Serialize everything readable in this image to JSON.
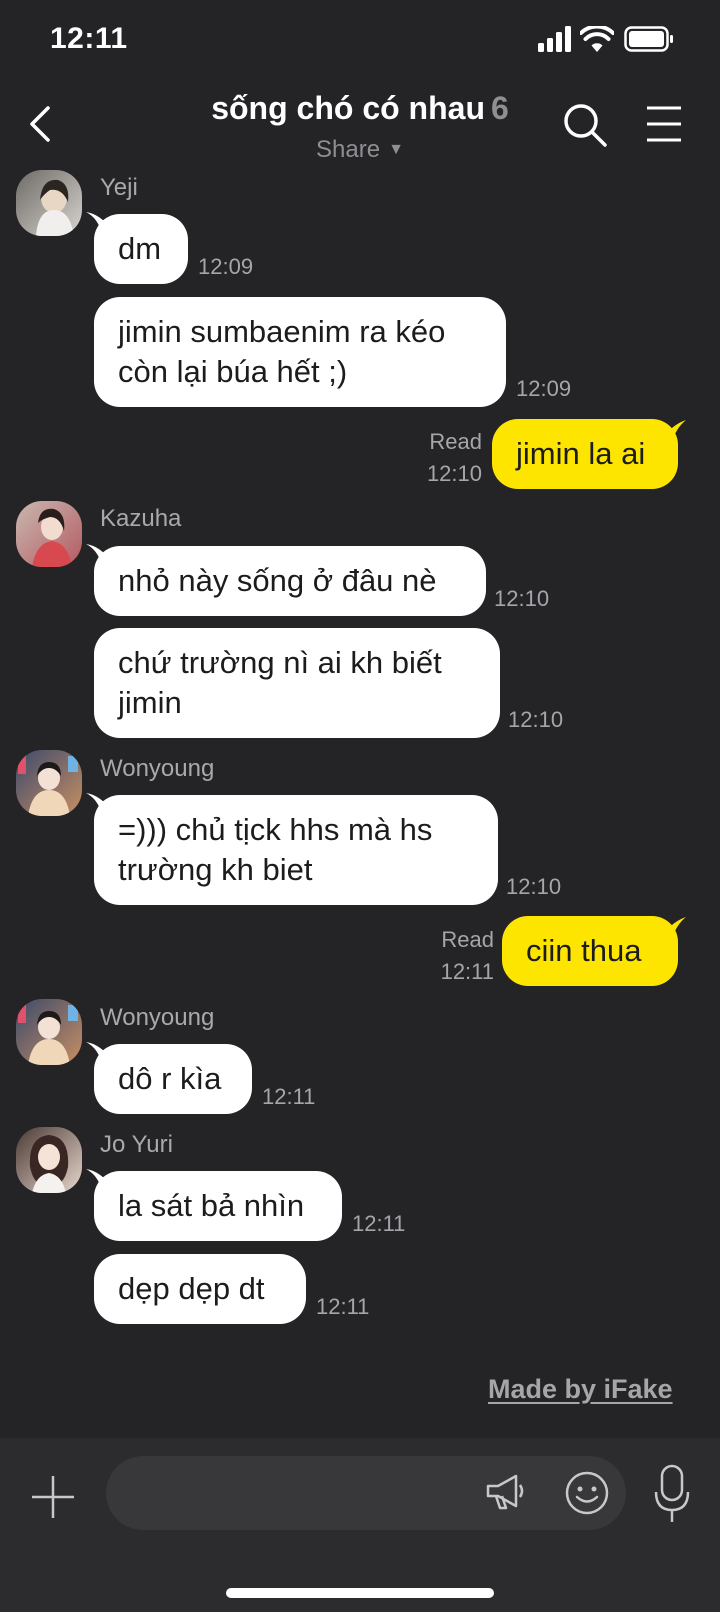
{
  "status_bar": {
    "time": "12:11"
  },
  "header": {
    "title": "sống chó có nhau",
    "member_count": "6",
    "subtitle": "Share"
  },
  "senders": {
    "yeji": "Yeji",
    "kazuha": "Kazuha",
    "wonyoung1": "Wonyoung",
    "wonyoung2": "Wonyoung",
    "joyuri": "Jo Yuri"
  },
  "messages": {
    "m1": {
      "text": "dm",
      "time": "12:09"
    },
    "m2": {
      "text": "jimin sumbaenim ra kéo\ncòn lại búa hết ;)",
      "time": "12:09"
    },
    "m3": {
      "text": "jimin la ai",
      "read": "Read",
      "time": "12:10"
    },
    "m4": {
      "text": "nhỏ này sống ở đâu nè",
      "time": "12:10"
    },
    "m5": {
      "text": "chứ trường nì ai kh biết\njimin",
      "time": "12:10"
    },
    "m6": {
      "text": "=))) chủ tịck hhs mà hs\ntrường kh biet",
      "time": "12:10"
    },
    "m7": {
      "text": "ciin thua",
      "read": "Read",
      "time": "12:11"
    },
    "m8": {
      "text": "dô r kìa",
      "time": "12:11"
    },
    "m9": {
      "text": "la sát bả nhìn",
      "time": "12:11"
    },
    "m10": {
      "text": "dẹp dẹp dt",
      "time": "12:11"
    }
  },
  "watermark": "Made by iFake",
  "input": {
    "placeholder": ""
  },
  "colors": {
    "background": "#242427",
    "my_bubble": "#fee500",
    "their_bubble": "#ffffff",
    "muted_text": "#a5a5aa"
  }
}
